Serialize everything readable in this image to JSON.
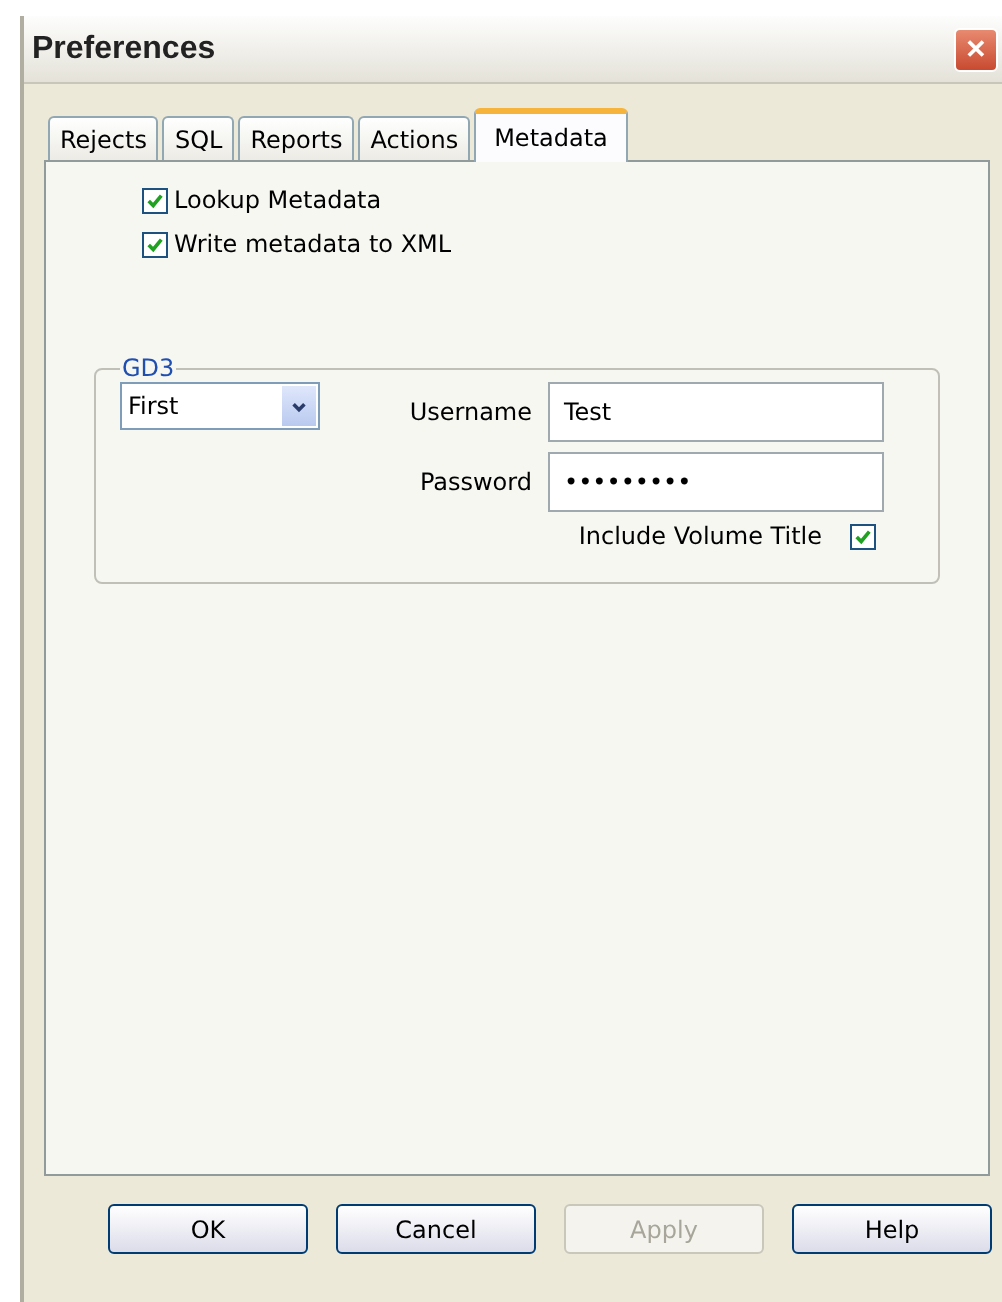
{
  "window": {
    "title": "Preferences",
    "close": "✕"
  },
  "tabs": [
    {
      "label": "Rejects",
      "selected": false
    },
    {
      "label": "SQL",
      "selected": false
    },
    {
      "label": "Reports",
      "selected": false
    },
    {
      "label": "Actions",
      "selected": false
    },
    {
      "label": "Metadata",
      "selected": true
    }
  ],
  "options": [
    {
      "label": "Lookup Metadata",
      "checked": true
    },
    {
      "label": "Write metadata to XML",
      "checked": true
    }
  ],
  "group": {
    "title": "GD3",
    "dropdown": {
      "value": "First"
    },
    "username": {
      "label": "Username",
      "value": "Test"
    },
    "password": {
      "label": "Password",
      "value": "•••••••••"
    },
    "include_volume_title": {
      "label": "Include Volume Title",
      "checked": true
    }
  },
  "buttons": [
    {
      "label": "OK",
      "disabled": false
    },
    {
      "label": "Cancel",
      "disabled": false
    },
    {
      "label": "Apply",
      "disabled": true
    },
    {
      "label": "Help",
      "disabled": false
    }
  ]
}
